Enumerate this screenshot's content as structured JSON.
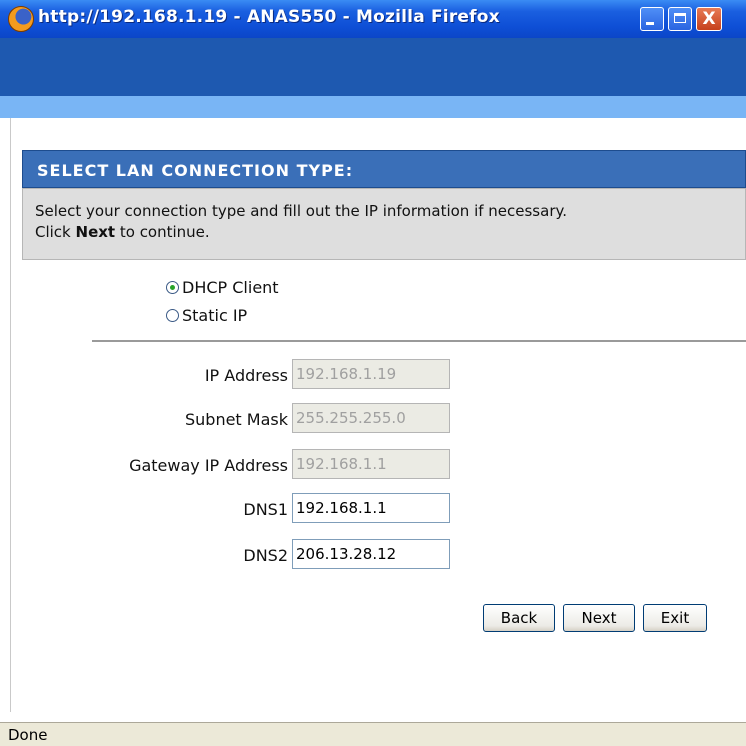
{
  "window": {
    "title": "http://192.168.1.19 - ANAS550 - Mozilla Firefox",
    "icon": "firefox-icon",
    "controls": [
      "minimize-icon",
      "maximize-icon",
      "close-icon"
    ],
    "close_glyph": "X"
  },
  "section": {
    "heading": "SELECT LAN CONNECTION TYPE:",
    "description_line1": "Select your connection type and fill out the IP information if necessary.",
    "description_prefix": "Click ",
    "description_bold": "Next",
    "description_suffix": " to continue."
  },
  "connection_type": {
    "options": [
      {
        "label": "DHCP Client",
        "checked": true
      },
      {
        "label": "Static IP",
        "checked": false
      }
    ]
  },
  "fields": {
    "ip_address": {
      "label": "IP Address",
      "value": "192.168.1.19",
      "enabled": false
    },
    "subnet_mask": {
      "label": "Subnet Mask",
      "value": "255.255.255.0",
      "enabled": false
    },
    "gateway": {
      "label": "Gateway IP Address",
      "value": "192.168.1.1",
      "enabled": false
    },
    "dns1": {
      "label": "DNS1",
      "value": "192.168.1.1",
      "enabled": true
    },
    "dns2": {
      "label": "DNS2",
      "value": "206.13.28.12",
      "enabled": true
    }
  },
  "buttons": {
    "back": "Back",
    "next": "Next",
    "exit": "Exit"
  },
  "status": {
    "text": "Done"
  },
  "colors": {
    "titlebar": "#0b46c8",
    "header_band": "#1e59b0",
    "header_stripe": "#79b5f5",
    "section_head": "#3a6fb8",
    "radio_checked": "#29a329"
  }
}
